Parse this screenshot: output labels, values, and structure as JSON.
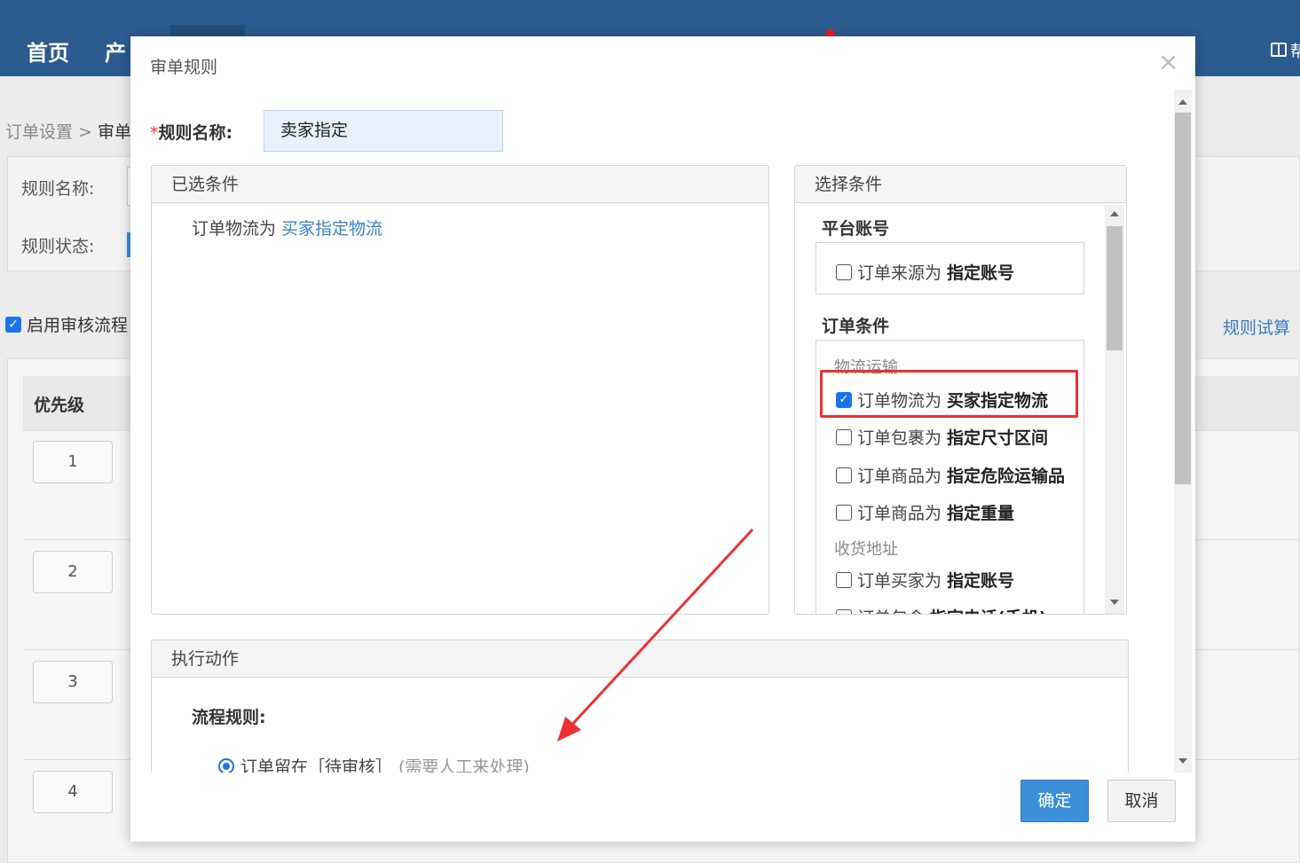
{
  "nav": {
    "home": "首页",
    "product": "产",
    "help": "帮"
  },
  "background": {
    "breadcrumb_parent": "订单设置",
    "breadcrumb_sep": ">",
    "breadcrumb_current": "审单",
    "filter_name_label": "规则名称:",
    "filter_status_label": "规则状态:",
    "enable_flow": "启用审核流程",
    "rule_test": "规则试算",
    "table_header_priority": "优先级",
    "priorities": [
      "1",
      "2",
      "3",
      "4"
    ]
  },
  "modal": {
    "title": "审单规则",
    "close": "×",
    "name_required": "*",
    "name_label": "规则名称:",
    "name_value": "卖家指定",
    "selected_panel_title": "已选条件",
    "selected_condition_prefix": "订单物流为 ",
    "selected_condition_value": "买家指定物流",
    "choose_panel_title": "选择条件",
    "platform_group": "平台账号",
    "platform_option_prefix": "订单来源为",
    "platform_option_bold": "指定账号",
    "order_group": "订单条件",
    "logistics_sub": "物流运输",
    "options": [
      {
        "prefix": "订单物流为",
        "bold": "买家指定物流",
        "checked": true
      },
      {
        "prefix": "订单包裹为",
        "bold": "指定尺寸区间",
        "checked": false
      },
      {
        "prefix": "订单商品为",
        "bold": "指定危险运输品",
        "checked": false
      },
      {
        "prefix": "订单商品为",
        "bold": "指定重量",
        "checked": false
      }
    ],
    "address_sub": "收货地址",
    "address_options": [
      {
        "prefix": "订单买家为",
        "bold": "指定账号"
      },
      {
        "prefix": "订单包含",
        "bold": "指定电话(手机)"
      }
    ],
    "action_panel_title": "执行动作",
    "flow_rule_label": "流程规则:",
    "radio_text": "订单留在［待审核］",
    "radio_note": "(需要人工来处理)",
    "ok": "确定",
    "cancel": "取消"
  },
  "colors": {
    "nav_bg": "#2c5b8f",
    "primary": "#3d8fd8",
    "highlight_link": "#3a82cc",
    "annotation_red": "#f03030"
  }
}
